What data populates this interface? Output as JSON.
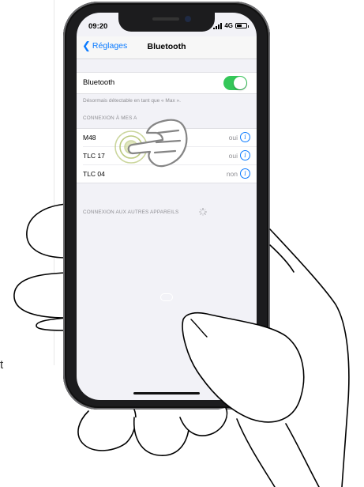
{
  "side_text": "t",
  "status_bar": {
    "time": "09:20",
    "network": "4G"
  },
  "nav": {
    "back_label": "Réglages",
    "title": "Bluetooth"
  },
  "bluetooth": {
    "label": "Bluetooth",
    "enabled": true,
    "discoverable_text": "Désormais détectable en tant que « Max »."
  },
  "my_devices": {
    "header": "CONNEXION À MES A",
    "items": [
      {
        "name": "M48",
        "status": "oui"
      },
      {
        "name": "TLC 17",
        "status": "oui"
      },
      {
        "name": "TLC 04",
        "status": "non"
      }
    ]
  },
  "other_devices": {
    "header": "CONNEXION AUX AUTRES APPAREILS"
  },
  "colors": {
    "accent": "#0a7aff",
    "toggle_on": "#34c759",
    "background": "#f2f2f7"
  },
  "icons": [
    "chevron-left-icon",
    "info-icon",
    "loading-spinner-icon",
    "pointing-finger-icon",
    "tap-ripple-icon"
  ]
}
